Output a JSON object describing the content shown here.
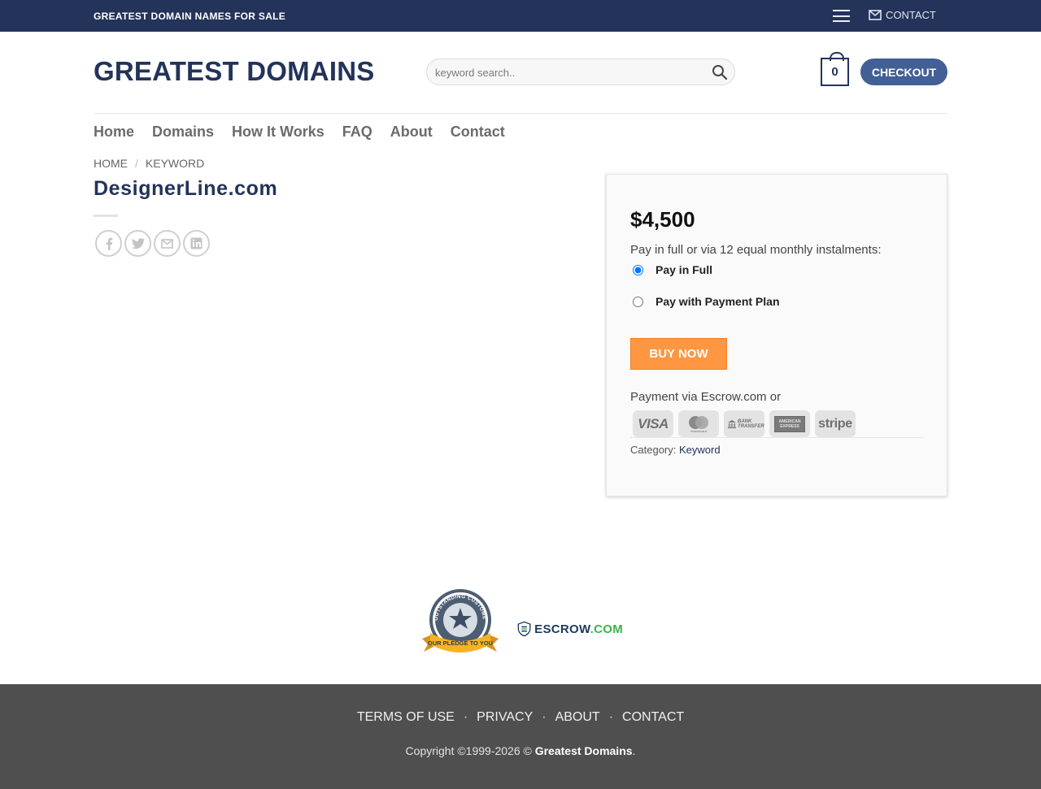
{
  "topbar": {
    "tagline": "GREATEST DOMAIN NAMES FOR SALE",
    "contact_label": "CONTACT"
  },
  "header": {
    "logo": "GREATEST DOMAINS",
    "search_placeholder": "keyword search..",
    "cart_count": "0",
    "checkout_label": "CHECKOUT"
  },
  "nav": {
    "items": [
      "Home",
      "Domains",
      "How It Works",
      "FAQ",
      "About",
      "Contact"
    ]
  },
  "breadcrumb": {
    "home": "HOME",
    "separator": "/",
    "current": "KEYWORD"
  },
  "product": {
    "title": "DesignerLine.com",
    "share_icons": [
      "facebook-icon",
      "twitter-icon",
      "email-icon",
      "linkedin-icon"
    ]
  },
  "purchase": {
    "price": "$4,500",
    "intro": "Pay in full or via 12 equal monthly instalments:",
    "options": [
      {
        "label": "Pay in Full",
        "selected": true
      },
      {
        "label": "Pay with Payment Plan",
        "selected": false
      }
    ],
    "buy_label": "BUY NOW",
    "escrow_line": "Payment via Escrow.com or",
    "payment_methods": [
      {
        "icon": "visa-icon",
        "label": "VISA"
      },
      {
        "icon": "mastercard-icon",
        "label": "mastercard"
      },
      {
        "icon": "bank-transfer-icon",
        "label": "BANK TRANSFER"
      },
      {
        "icon": "american-express-icon",
        "label": "AMERICAN EXPRESS"
      },
      {
        "icon": "stripe-icon",
        "label": "stripe"
      }
    ],
    "category_label": "Category:",
    "category_value": "Keyword"
  },
  "badges": {
    "pledge_ring_text": "OUTSTANDING CUSTOMER SERVICE",
    "pledge_ribbon_text": "OUR PLEDGE TO YOU",
    "escrow_main": "ESCROW",
    "escrow_suffix": ".COM"
  },
  "footer": {
    "links": [
      "TERMS OF USE",
      "PRIVACY",
      "ABOUT",
      "CONTACT"
    ],
    "separator": "·",
    "copyright_prefix": "Copyright ©1999-2026 ©",
    "copyright_brand": "Greatest Domains",
    "copyright_suffix": "."
  },
  "colors": {
    "brand_navy": "#23335a",
    "checkout_blue": "#425f96",
    "buy_orange": "#fe9642",
    "footer_gray": "#4f4f4f"
  }
}
